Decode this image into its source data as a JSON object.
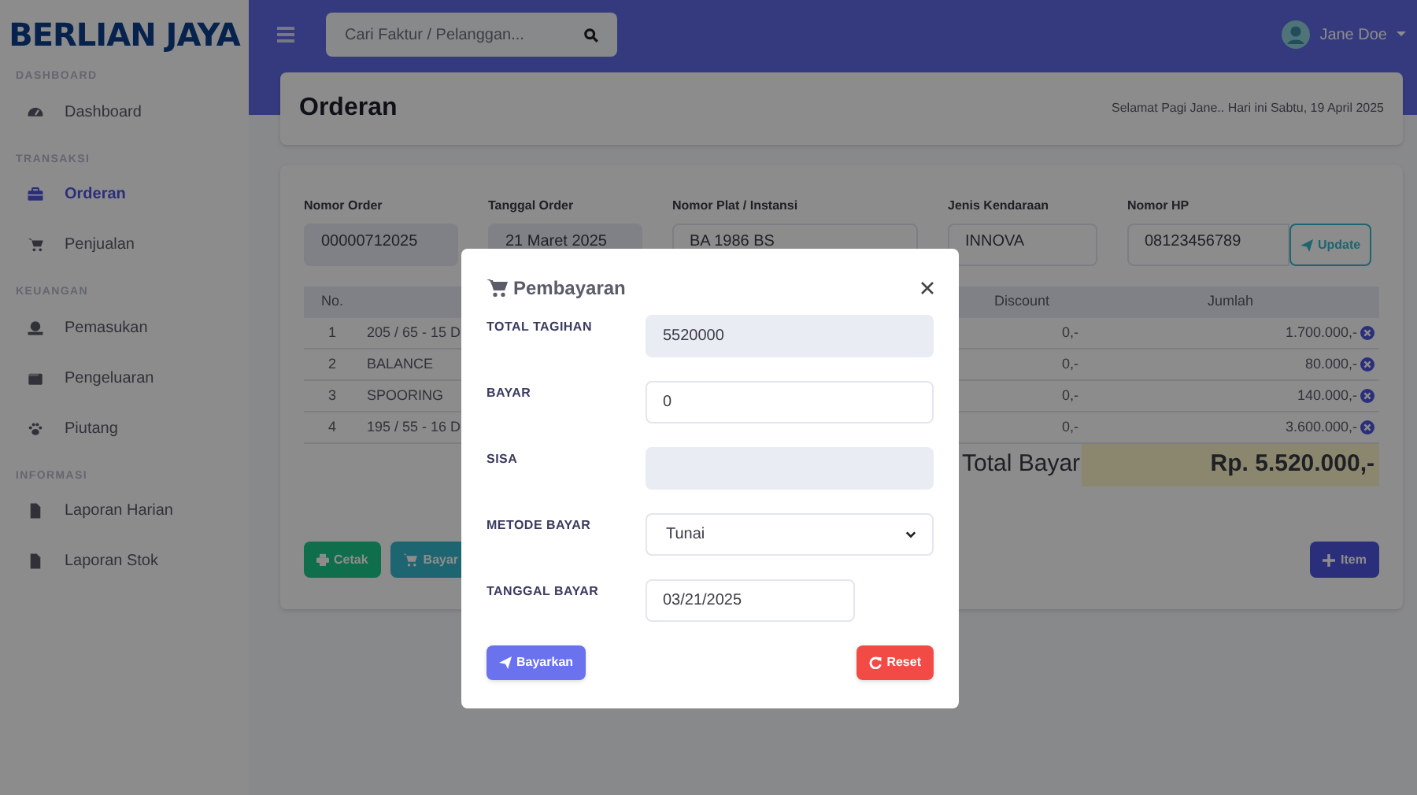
{
  "logo": "BERLIAN JAYA",
  "topbar": {
    "search_placeholder": "Cari Faktur / Pelanggan...",
    "user": "Jane Doe"
  },
  "sidebar": [
    {
      "heading": "DASHBOARD",
      "items": [
        {
          "label": "Dashboard",
          "selected": false
        }
      ]
    },
    {
      "heading": "TRANSAKSI",
      "items": [
        {
          "label": "Orderan",
          "selected": true
        },
        {
          "label": "Penjualan",
          "selected": false
        }
      ]
    },
    {
      "heading": "KEUANGAN",
      "items": [
        {
          "label": "Pemasukan",
          "selected": false
        },
        {
          "label": "Pengeluaran",
          "selected": false
        },
        {
          "label": "Piutang",
          "selected": false
        }
      ]
    },
    {
      "heading": "INFORMASI",
      "items": [
        {
          "label": "Laporan Harian",
          "selected": false
        },
        {
          "label": "Laporan Stok",
          "selected": false
        }
      ]
    }
  ],
  "page_header": {
    "title": "Orderan",
    "greeting": "Selamat Pagi Jane.. Hari ini Sabtu, 19 April 2025"
  },
  "order_form": {
    "fields": [
      {
        "label": "Nomor Order",
        "value": "00000712025",
        "readonly": true
      },
      {
        "label": "Tanggal Order",
        "value": "21 Maret 2025",
        "readonly": true
      },
      {
        "label": "Nomor Plat / Instansi",
        "value": "BA 1986 BS",
        "readonly": false
      },
      {
        "label": "Jenis Kendaraan",
        "value": "INNOVA",
        "readonly": false
      },
      {
        "label": "Nomor HP",
        "value": "08123456789",
        "readonly": false
      }
    ],
    "update_button": "Update"
  },
  "table": {
    "columns": [
      "No.",
      "Discount",
      "Jumlah"
    ],
    "rows": [
      {
        "no": "1",
        "item": "205 / 65 - 15 D",
        "discount": "0,-",
        "amount": "1.700.000,-"
      },
      {
        "no": "2",
        "item": "BALANCE",
        "discount": "0,-",
        "amount": "80.000,-"
      },
      {
        "no": "3",
        "item": "SPOORING",
        "discount": "0,-",
        "amount": "140.000,-"
      },
      {
        "no": "4",
        "item": "195 / 55 - 16 D",
        "discount": "0,-",
        "amount": "3.600.000,-"
      }
    ],
    "total_label": "Total Bayar",
    "total_value": "Rp. 5.520.000,-"
  },
  "actions": {
    "print": "Cetak",
    "pay": "Bayar",
    "add_item": "Item"
  },
  "modal": {
    "title": "Pembayaran",
    "fields": [
      {
        "kind": "input",
        "label": "TOTAL TAGIHAN",
        "value": "5520000",
        "readonly": true
      },
      {
        "kind": "input",
        "label": "BAYAR",
        "value": "0",
        "readonly": false
      },
      {
        "kind": "input",
        "label": "SISA",
        "readonly": true
      },
      {
        "kind": "select",
        "label": "METODE BAYAR",
        "value": "Tunai",
        "readonly": false
      },
      {
        "kind": "date",
        "label": "TANGGAL BAYAR",
        "value": "03/21/2025",
        "readonly": false
      }
    ],
    "submit": "Bayarkan",
    "reset": "Reset"
  }
}
